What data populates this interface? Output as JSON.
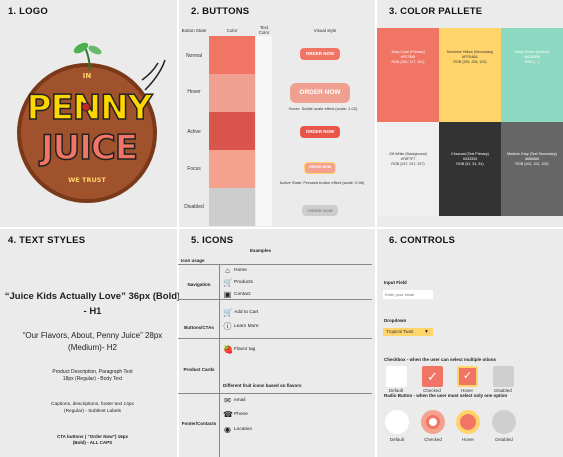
{
  "logo": {
    "title": "1. LOGO",
    "wordmark_line1": "PENNY",
    "wordmark_line2": "JUICE",
    "top_text": "IN",
    "bottom_text": "WE TRUST"
  },
  "buttons": {
    "title": "2. BUTTONS",
    "headers": {
      "state": "Button State",
      "color": "Color",
      "text_color": "Text Color",
      "visual": "Visual style"
    },
    "button_label": "ORDER NOW",
    "states": [
      "Normal",
      "Hover",
      "Active",
      "Focus",
      "Disabled"
    ],
    "hover_note": "Hover: Subtle scale effect (scale: 1.02)",
    "active_note": "Active State: Pressed button effect (scale: 0.98)",
    "colors": {
      "normal": "#f07565",
      "hover": "#f0a090",
      "active": "#d9544a",
      "focus": "#f4a18e",
      "disabled": "#cdcdcd"
    }
  },
  "palette": {
    "title": "3. COLOR PALLETE",
    "swatches": [
      {
        "label": "Juicy Coral (Primary)\n#F07565\nRGB (240, 117, 101)",
        "color": "#f07565",
        "text_color": "#ffffff"
      },
      {
        "label": "Sunshine Yellow (Secondary)\n#FFD46A\nRGB (255, 205, 103)",
        "color": "#ffd46a",
        "text_color": "#333333"
      },
      {
        "label": "Minty Green (Accent)\n#8DD6BB\nRGB (...)",
        "color": "#8dd8c0",
        "text_color": "#ffffff"
      },
      {
        "label": "Off-White (Background)\n#F8F7F7\nRGB (247, 247, 247)",
        "color": "#efefef",
        "text_color": "#333333"
      },
      {
        "label": "Charcoal (Text Primary)\n#333333\nRGB (51, 51, 51)",
        "color": "#333333",
        "text_color": "#ffffff"
      },
      {
        "label": "Medium Gray (Text Secondary)\n#666666\nRGB (102, 102, 102)",
        "color": "#666666",
        "text_color": "#ffffff"
      }
    ]
  },
  "text_styles": {
    "title": "4. TEXT STYLES",
    "h1": "“Juice Kids Actually Love” 36px (Bold) - H1",
    "h2": "“Our Flavors, About, Penny Juice” 28px (Medium)- H2",
    "body": "Product Description, Paragraph Text 18px (Regular) - Body Text",
    "subtle": "Captions, descriptions, footer text 14px (Regular) - Subtlest Labels",
    "cta": "CTA buttons ( “Order Now”) 16px (Bold) - ALL CAPS"
  },
  "icons": {
    "title": "5. ICONS",
    "examples_header": "Examples",
    "icon_usage_header": "Icon usage",
    "categories": {
      "navigation": "Navigation",
      "buttons": "Buttons/CTAs",
      "product": "Product Cards",
      "footer": "Footer/Contacts"
    },
    "items": {
      "home": "Home",
      "products": "Products",
      "contact": "Contact",
      "add_to_cart": "Add to Cart",
      "learn_more": "Learn More",
      "flavor_tag": "Flavor tag",
      "fruit_note": "Different fruit icons based on flavors",
      "email": "email",
      "phone": "Phone",
      "location": "Location"
    }
  },
  "controls": {
    "title": "6. CONTROLS",
    "input_label": "Input Field",
    "input_placeholder": "Enter your email",
    "dropdown_label": "Dropdown",
    "dropdown_value": "Tropical Twist",
    "checkbox_label": "Checkbox -  when the user can select multiple otions",
    "radio_label": "Radio Button - when the user must select only one option",
    "states": [
      "Default",
      "Checked",
      "Hover",
      "Disabled"
    ]
  }
}
